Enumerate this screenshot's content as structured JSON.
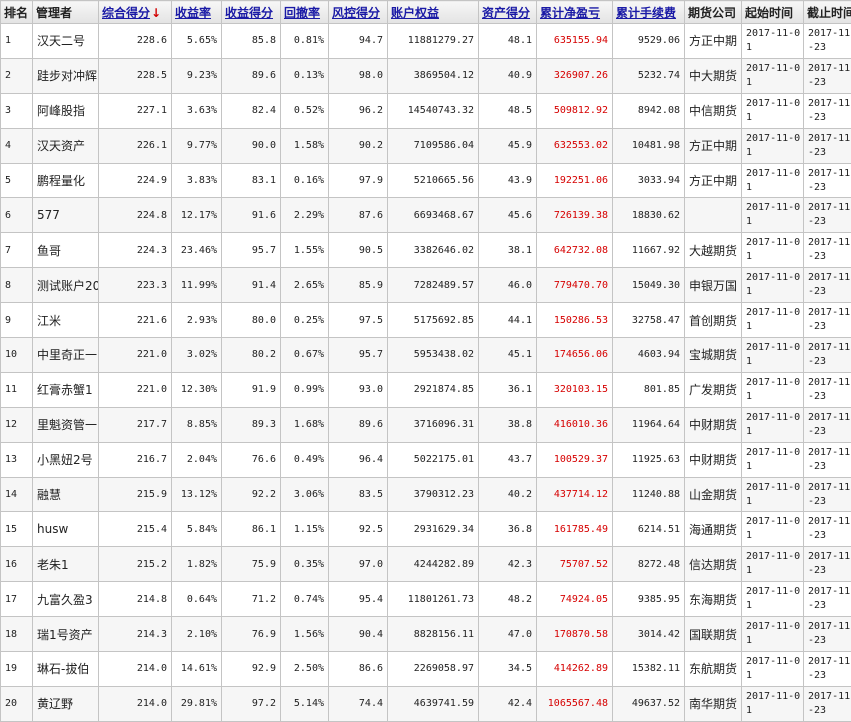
{
  "headers": {
    "rank": "排名",
    "manager": "管理者",
    "total_score": "综合得分",
    "sort_arrow": "↓",
    "return_rate": "收益率",
    "return_score": "收益得分",
    "drawdown": "回撤率",
    "risk_score": "风控得分",
    "equity": "账户权益",
    "asset_score": "资产得分",
    "net_pnl": "累计净盈亏",
    "fees": "累计手续费",
    "broker": "期货公司",
    "start_date": "起始时间",
    "end_date": "截止时间"
  },
  "colors": {
    "pnl": "#d60000",
    "header_link": "#1a1aa6",
    "sort_arrow": "#d20000"
  },
  "rows": [
    {
      "rank": "1",
      "name": "汉天二号",
      "score": "228.6",
      "ret": "5.65%",
      "ret_score": "85.8",
      "dd": "0.81%",
      "risk": "94.7",
      "equity": "11881279.27",
      "asset": "48.1",
      "pnl": "635155.94",
      "fee": "9529.06",
      "broker": "方正中期",
      "start": "2017-11-01",
      "end": "2017-11-23"
    },
    {
      "rank": "2",
      "name": "跬步对冲辉",
      "score": "228.5",
      "ret": "9.23%",
      "ret_score": "89.6",
      "dd": "0.13%",
      "risk": "98.0",
      "equity": "3869504.12",
      "asset": "40.9",
      "pnl": "326907.26",
      "fee": "5232.74",
      "broker": "中大期货",
      "start": "2017-11-01",
      "end": "2017-11-23"
    },
    {
      "rank": "3",
      "name": "阿峰股指",
      "score": "227.1",
      "ret": "3.63%",
      "ret_score": "82.4",
      "dd": "0.52%",
      "risk": "96.2",
      "equity": "14540743.32",
      "asset": "48.5",
      "pnl": "509812.92",
      "fee": "8942.08",
      "broker": "中信期货",
      "start": "2017-11-01",
      "end": "2017-11-23"
    },
    {
      "rank": "4",
      "name": "汉天资产",
      "score": "226.1",
      "ret": "9.77%",
      "ret_score": "90.0",
      "dd": "1.58%",
      "risk": "90.2",
      "equity": "7109586.04",
      "asset": "45.9",
      "pnl": "632553.02",
      "fee": "10481.98",
      "broker": "方正中期",
      "start": "2017-11-01",
      "end": "2017-11-23"
    },
    {
      "rank": "5",
      "name": "鹏程量化",
      "score": "224.9",
      "ret": "3.83%",
      "ret_score": "83.1",
      "dd": "0.16%",
      "risk": "97.9",
      "equity": "5210665.56",
      "asset": "43.9",
      "pnl": "192251.06",
      "fee": "3033.94",
      "broker": "方正中期",
      "start": "2017-11-01",
      "end": "2017-11-23"
    },
    {
      "rank": "6",
      "name": "577",
      "score": "224.8",
      "ret": "12.17%",
      "ret_score": "91.6",
      "dd": "2.29%",
      "risk": "87.6",
      "equity": "6693468.67",
      "asset": "45.6",
      "pnl": "726139.38",
      "fee": "18830.62",
      "broker": "",
      "start": "2017-11-01",
      "end": "2017-11-23"
    },
    {
      "rank": "7",
      "name": "鱼哥",
      "score": "224.3",
      "ret": "23.46%",
      "ret_score": "95.7",
      "dd": "1.55%",
      "risk": "90.5",
      "equity": "3382646.02",
      "asset": "38.1",
      "pnl": "642732.08",
      "fee": "11667.92",
      "broker": "大越期货",
      "start": "2017-11-01",
      "end": "2017-11-23"
    },
    {
      "rank": "8",
      "name": "测试账户20",
      "score": "223.3",
      "ret": "11.99%",
      "ret_score": "91.4",
      "dd": "2.65%",
      "risk": "85.9",
      "equity": "7282489.57",
      "asset": "46.0",
      "pnl": "779470.70",
      "fee": "15049.30",
      "broker": "申银万国",
      "start": "2017-11-01",
      "end": "2017-11-23"
    },
    {
      "rank": "9",
      "name": "江米",
      "score": "221.6",
      "ret": "2.93%",
      "ret_score": "80.0",
      "dd": "0.25%",
      "risk": "97.5",
      "equity": "5175692.85",
      "asset": "44.1",
      "pnl": "150286.53",
      "fee": "32758.47",
      "broker": "首创期货",
      "start": "2017-11-01",
      "end": "2017-11-23"
    },
    {
      "rank": "10",
      "name": "中里奇正一",
      "score": "221.0",
      "ret": "3.02%",
      "ret_score": "80.2",
      "dd": "0.67%",
      "risk": "95.7",
      "equity": "5953438.02",
      "asset": "45.1",
      "pnl": "174656.06",
      "fee": "4603.94",
      "broker": "宝城期货",
      "start": "2017-11-01",
      "end": "2017-11-23"
    },
    {
      "rank": "11",
      "name": "红膏赤蟹1",
      "score": "221.0",
      "ret": "12.30%",
      "ret_score": "91.9",
      "dd": "0.99%",
      "risk": "93.0",
      "equity": "2921874.85",
      "asset": "36.1",
      "pnl": "320103.15",
      "fee": "801.85",
      "broker": "广发期货",
      "start": "2017-11-01",
      "end": "2017-11-23"
    },
    {
      "rank": "12",
      "name": "里魁资管一",
      "score": "217.7",
      "ret": "8.85%",
      "ret_score": "89.3",
      "dd": "1.68%",
      "risk": "89.6",
      "equity": "3716096.31",
      "asset": "38.8",
      "pnl": "416010.36",
      "fee": "11964.64",
      "broker": "中财期货",
      "start": "2017-11-01",
      "end": "2017-11-23"
    },
    {
      "rank": "13",
      "name": "小黑妞2号",
      "score": "216.7",
      "ret": "2.04%",
      "ret_score": "76.6",
      "dd": "0.49%",
      "risk": "96.4",
      "equity": "5022175.01",
      "asset": "43.7",
      "pnl": "100529.37",
      "fee": "11925.63",
      "broker": "中财期货",
      "start": "2017-11-01",
      "end": "2017-11-23"
    },
    {
      "rank": "14",
      "name": "融慧",
      "score": "215.9",
      "ret": "13.12%",
      "ret_score": "92.2",
      "dd": "3.06%",
      "risk": "83.5",
      "equity": "3790312.23",
      "asset": "40.2",
      "pnl": "437714.12",
      "fee": "11240.88",
      "broker": "山金期货",
      "start": "2017-11-01",
      "end": "2017-11-23"
    },
    {
      "rank": "15",
      "name": "husw",
      "score": "215.4",
      "ret": "5.84%",
      "ret_score": "86.1",
      "dd": "1.15%",
      "risk": "92.5",
      "equity": "2931629.34",
      "asset": "36.8",
      "pnl": "161785.49",
      "fee": "6214.51",
      "broker": "海通期货",
      "start": "2017-11-01",
      "end": "2017-11-23"
    },
    {
      "rank": "16",
      "name": "老朱1",
      "score": "215.2",
      "ret": "1.82%",
      "ret_score": "75.9",
      "dd": "0.35%",
      "risk": "97.0",
      "equity": "4244282.89",
      "asset": "42.3",
      "pnl": "75707.52",
      "fee": "8272.48",
      "broker": "信达期货",
      "start": "2017-11-01",
      "end": "2017-11-23"
    },
    {
      "rank": "17",
      "name": "九富久盈3",
      "score": "214.8",
      "ret": "0.64%",
      "ret_score": "71.2",
      "dd": "0.74%",
      "risk": "95.4",
      "equity": "11801261.73",
      "asset": "48.2",
      "pnl": "74924.05",
      "fee": "9385.95",
      "broker": "东海期货",
      "start": "2017-11-01",
      "end": "2017-11-23"
    },
    {
      "rank": "18",
      "name": "瑞1号资产",
      "score": "214.3",
      "ret": "2.10%",
      "ret_score": "76.9",
      "dd": "1.56%",
      "risk": "90.4",
      "equity": "8828156.11",
      "asset": "47.0",
      "pnl": "170870.58",
      "fee": "3014.42",
      "broker": "国联期货",
      "start": "2017-11-01",
      "end": "2017-11-23"
    },
    {
      "rank": "19",
      "name": "琳石-拔伯",
      "score": "214.0",
      "ret": "14.61%",
      "ret_score": "92.9",
      "dd": "2.50%",
      "risk": "86.6",
      "equity": "2269058.97",
      "asset": "34.5",
      "pnl": "414262.89",
      "fee": "15382.11",
      "broker": "东航期货",
      "start": "2017-11-01",
      "end": "2017-11-23"
    },
    {
      "rank": "20",
      "name": "黄辽野",
      "score": "214.0",
      "ret": "29.81%",
      "ret_score": "97.2",
      "dd": "5.14%",
      "risk": "74.4",
      "equity": "4639741.59",
      "asset": "42.4",
      "pnl": "1065567.48",
      "fee": "49637.52",
      "broker": "南华期货",
      "start": "2017-11-01",
      "end": "2017-11-23"
    }
  ]
}
